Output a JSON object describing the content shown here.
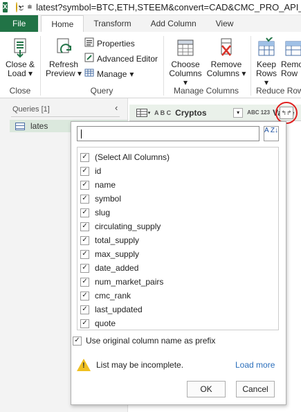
{
  "titlebar": {
    "logo": "X",
    "title": "latest?symbol=BTC,ETH,STEEM&convert=CAD&CMC_PRO_API_K"
  },
  "tabs": [
    "File",
    "Home",
    "Transform",
    "Add Column",
    "View"
  ],
  "ribbon": {
    "close_load": "Close &",
    "close_load2": "Load",
    "refresh": "Refresh",
    "preview": "Preview",
    "properties": "Properties",
    "advanced_editor": "Advanced Editor",
    "manage": "Manage",
    "choose_columns": "Choose",
    "choose_columns2": "Columns",
    "remove_columns": "Remove",
    "remove_columns2": "Columns",
    "keep_rows": "Keep",
    "keep_rows2": "Rows",
    "remove_rows": "Remo",
    "remove_rows2": "Row",
    "groups": {
      "close": "Close",
      "query": "Query",
      "manage_columns": "Manage Columns",
      "reduce_rows": "Reduce Row"
    }
  },
  "queries": {
    "header": "Queries [1]",
    "item": "lates"
  },
  "column_header": {
    "col1_type": "A B C",
    "col1_name": "Cryptos",
    "col2_type": "ABC 123",
    "col2_name": "Value"
  },
  "popup": {
    "search_placeholder": "",
    "sort_icon_text": "A Z",
    "columns": [
      {
        "label": "(Select All Columns)",
        "checked": true
      },
      {
        "label": "id",
        "checked": true
      },
      {
        "label": "name",
        "checked": true
      },
      {
        "label": "symbol",
        "checked": true
      },
      {
        "label": "slug",
        "checked": true
      },
      {
        "label": "circulating_supply",
        "checked": true
      },
      {
        "label": "total_supply",
        "checked": true
      },
      {
        "label": "max_supply",
        "checked": true
      },
      {
        "label": "date_added",
        "checked": true
      },
      {
        "label": "num_market_pairs",
        "checked": true
      },
      {
        "label": "cmc_rank",
        "checked": true
      },
      {
        "label": "last_updated",
        "checked": true
      },
      {
        "label": "quote",
        "checked": true
      }
    ],
    "prefix_label": "Use original column name as prefix",
    "warning": "List may be incomplete.",
    "load_more": "Load more",
    "ok": "OK",
    "cancel": "Cancel"
  },
  "colors": {
    "brand_green": "#217346",
    "highlight_circle": "#e02020",
    "link": "#2a6ebb"
  }
}
